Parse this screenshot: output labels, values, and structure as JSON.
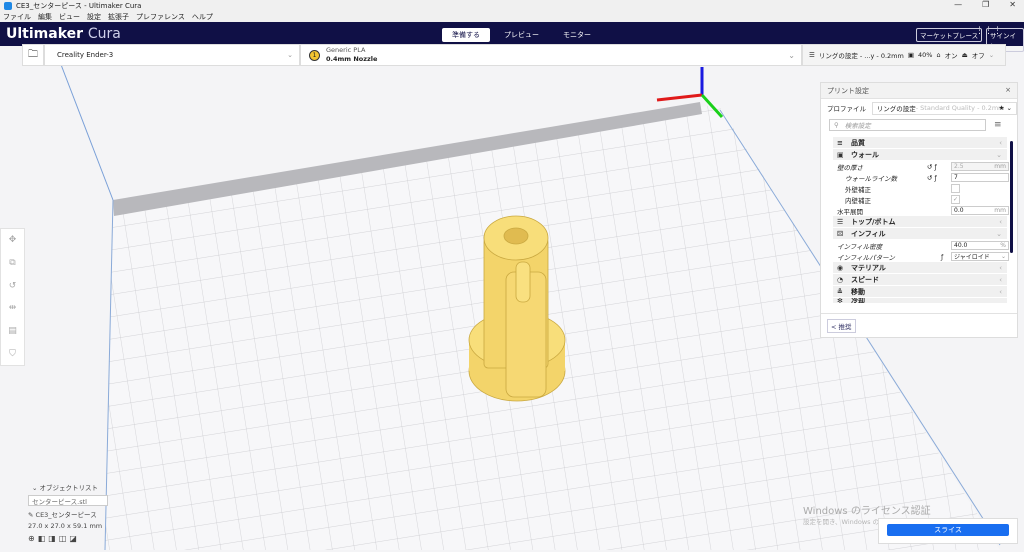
{
  "window": {
    "title": "CE3_センターピース - Ultimaker Cura",
    "minimize": "—",
    "maximize": "❐",
    "close": "✕"
  },
  "menu": [
    "ファイル",
    "編集",
    "ビュー",
    "設定",
    "拡張子",
    "プレファレンス",
    "ヘルプ"
  ],
  "header": {
    "logo_main": "Ultimaker",
    "logo_sub": "Cura",
    "stages": [
      "準備する",
      "プレビュー",
      "モニター"
    ],
    "marketplace": "マーケットプレース",
    "signin": "サインイン"
  },
  "toolbar": {
    "printer": "Creality Ender-3",
    "extruder_num": "1",
    "material": "Generic PLA",
    "nozzle": "0.4mm Nozzle",
    "profile_summary": "リングの設定 - ...y - 0.2mm",
    "infill": "40%",
    "support": "オン",
    "adhesion": "オフ"
  },
  "panel": {
    "title": "プリント設定",
    "profile_label": "プロファイル",
    "profile_name": "リングの設定",
    "profile_quality": " - Standard Quality - 0.2mm",
    "search_placeholder": "検索設定",
    "categories": {
      "quality": "品質",
      "wall": "ウォール",
      "topbottom": "トップ/ボトム",
      "infill": "インフィル",
      "material": "マテリアル",
      "speed": "スピード",
      "travel": "移動",
      "cooling": "冷却"
    },
    "settings": {
      "wall_thickness": {
        "label": "壁の厚さ",
        "value": "2.5",
        "unit": "mm"
      },
      "wall_line_count": {
        "label": "ウォールライン数",
        "value": "7"
      },
      "outer_wall": {
        "label": "外壁補正"
      },
      "inner_wall": {
        "label": "内壁補正",
        "check": "✓"
      },
      "horizontal_expansion": {
        "label": "水平展開",
        "value": "0.0",
        "unit": "mm"
      },
      "infill_density": {
        "label": "インフィル密度",
        "value": "40.0",
        "unit": "%"
      },
      "infill_pattern": {
        "label": "インフィルパターン",
        "value": "ジャイロイド"
      }
    },
    "recommended": "< 推奨"
  },
  "objects": {
    "header": "オブジェクトリスト",
    "file": "センターピース.stl",
    "name": "CE3_センターピース",
    "dims": "27.0 x 27.0 x 59.1 mm"
  },
  "watermark": {
    "line1": "Windows のライセンス認証",
    "line2": "設定を開き、Windows のライセンス認証を行ってください。"
  },
  "slice": "スライス"
}
